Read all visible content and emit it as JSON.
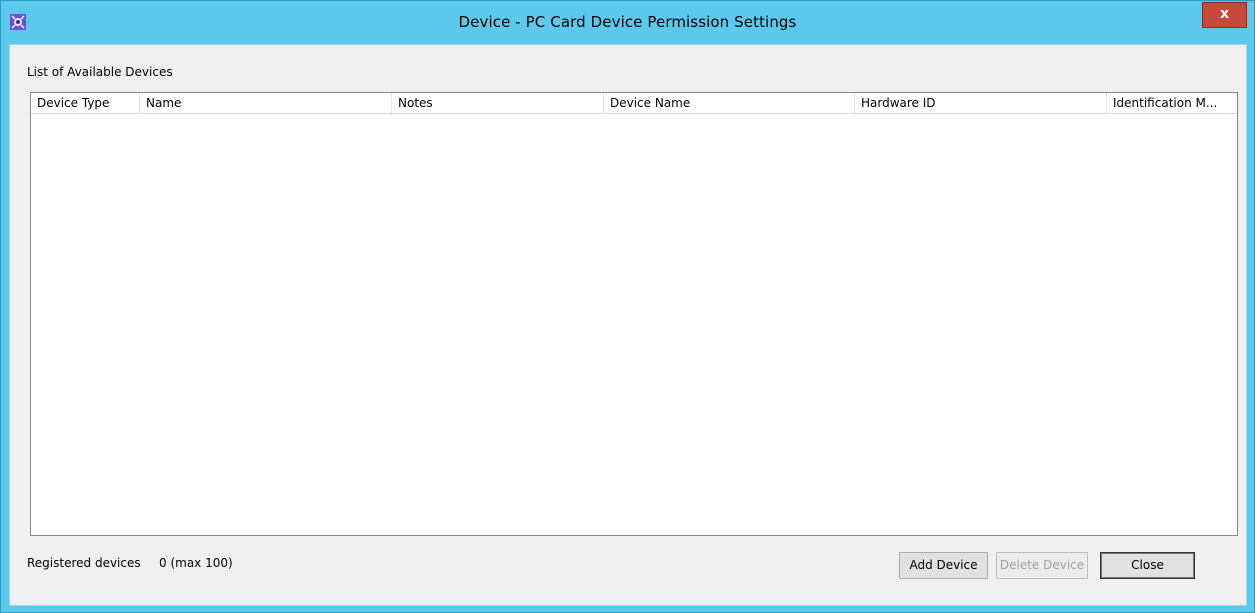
{
  "window": {
    "title": "Device - PC Card Device Permission Settings",
    "close_glyph": "x",
    "app_icon": "app-icon"
  },
  "list": {
    "caption": "List of Available Devices",
    "columns": [
      {
        "label": "Device Type"
      },
      {
        "label": "Name"
      },
      {
        "label": "Notes"
      },
      {
        "label": "Device Name"
      },
      {
        "label": "Hardware ID"
      },
      {
        "label": "Identification M..."
      }
    ],
    "rows": []
  },
  "footer": {
    "registered_label": "Registered devices",
    "registered_count": "0 (max 100)"
  },
  "buttons": {
    "add": "Add Device",
    "delete": "Delete Device",
    "close": "Close"
  },
  "colors": {
    "frame": "#5cc8ec",
    "close_button": "#c7493a",
    "client_background": "#f0f0f0"
  }
}
